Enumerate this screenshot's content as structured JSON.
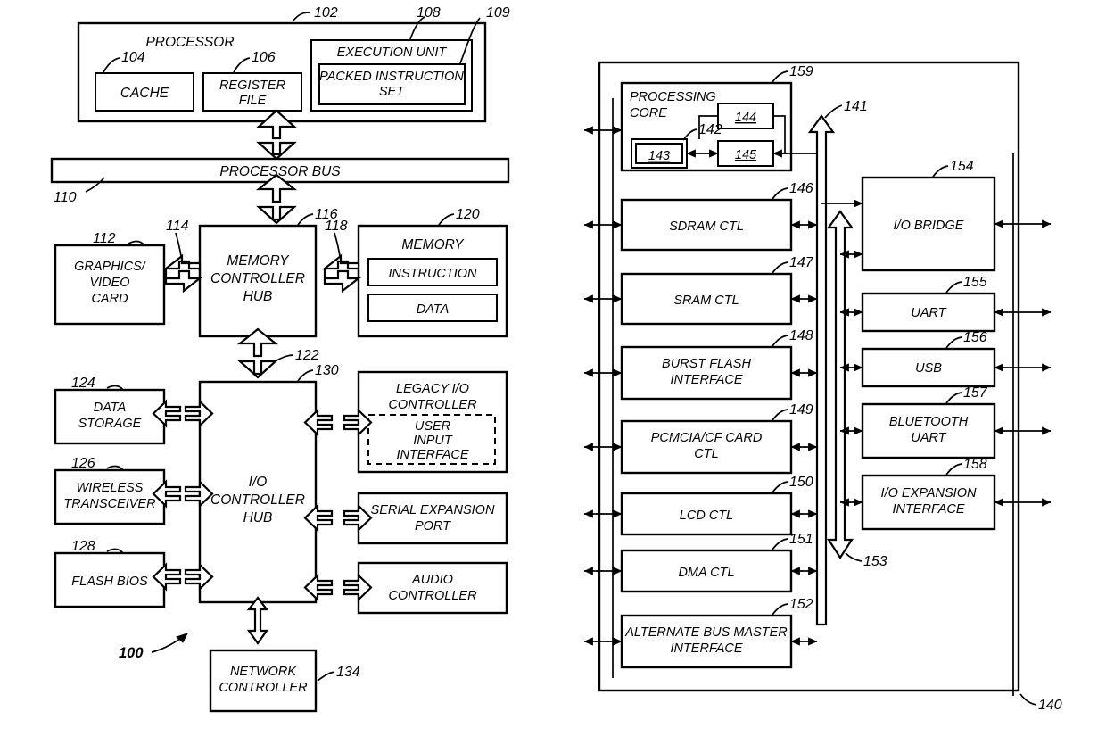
{
  "figure": {
    "title_left_ref": "100",
    "title_right_ref": "140"
  },
  "left_diagram": {
    "ref": "100",
    "processor": {
      "ref": "102",
      "label": "PROCESSOR",
      "cache": {
        "ref": "104",
        "label": "CACHE"
      },
      "register_file": {
        "ref": "106",
        "label": "REGISTER FILE",
        "line1": "REGISTER",
        "line2": "FILE"
      },
      "execution_unit": {
        "ref": "108",
        "label": "EXECUTION UNIT",
        "packed_instruction_set": {
          "ref": "109",
          "line1": "PACKED INSTRUCTION",
          "line2": "SET"
        }
      }
    },
    "processor_bus": {
      "ref": "110",
      "label": "PROCESSOR BUS"
    },
    "graphics_video_card": {
      "ref": "112",
      "line1": "GRAPHICS/",
      "line2": "VIDEO",
      "line3": "CARD"
    },
    "bus_114": {
      "ref": "114"
    },
    "memory_controller_hub": {
      "ref": "116",
      "line1": "MEMORY",
      "line2": "CONTROLLER",
      "line3": "HUB"
    },
    "bus_118": {
      "ref": "118"
    },
    "memory": {
      "ref": "120",
      "label": "MEMORY",
      "instruction": "INSTRUCTION",
      "data": "DATA"
    },
    "bus_122": {
      "ref": "122"
    },
    "data_storage": {
      "ref": "124",
      "line1": "DATA",
      "line2": "STORAGE"
    },
    "wireless_transceiver": {
      "ref": "126",
      "line1": "WIRELESS",
      "line2": "TRANSCEIVER"
    },
    "flash_bios": {
      "ref": "128",
      "label": "FLASH BIOS"
    },
    "io_controller_hub": {
      "ref": "130",
      "line1": "I/O",
      "line2": "CONTROLLER",
      "line3": "HUB"
    },
    "legacy_io_controller": {
      "line1": "LEGACY I/O",
      "line2": "CONTROLLER",
      "user_input_interface": {
        "line1": "USER",
        "line2": "INPUT",
        "line3": "INTERFACE"
      }
    },
    "serial_expansion_port": {
      "line1": "SERIAL EXPANSION",
      "line2": "PORT"
    },
    "audio_controller": {
      "line1": "AUDIO",
      "line2": "CONTROLLER"
    },
    "network_controller": {
      "ref": "134",
      "line1": "NETWORK",
      "line2": "CONTROLLER"
    }
  },
  "right_diagram": {
    "ref": "140",
    "processing_core": {
      "ref": "159",
      "line1": "PROCESSING",
      "line2": "CORE",
      "inner": {
        "cache_142": {
          "ref": "142"
        },
        "box_143": {
          "ref": "143"
        },
        "box_144": {
          "ref": "144"
        },
        "box_145": {
          "ref": "145"
        }
      }
    },
    "main_bus": {
      "ref": "141"
    },
    "io_bus": {
      "ref": "153"
    },
    "left_column": [
      {
        "ref": "146",
        "line1": "SDRAM CTL",
        "line2": ""
      },
      {
        "ref": "147",
        "line1": "SRAM CTL",
        "line2": ""
      },
      {
        "ref": "148",
        "line1": "BURST FLASH",
        "line2": "INTERFACE"
      },
      {
        "ref": "149",
        "line1": "PCMCIA/CF CARD",
        "line2": "CTL"
      },
      {
        "ref": "150",
        "line1": "LCD CTL",
        "line2": ""
      },
      {
        "ref": "151",
        "line1": "DMA CTL",
        "line2": ""
      },
      {
        "ref": "152",
        "line1": "ALTERNATE BUS MASTER",
        "line2": "INTERFACE"
      }
    ],
    "right_column": [
      {
        "ref": "154",
        "line1": "I/O BRIDGE",
        "line2": ""
      },
      {
        "ref": "155",
        "line1": "UART",
        "line2": ""
      },
      {
        "ref": "156",
        "line1": "USB",
        "line2": ""
      },
      {
        "ref": "157",
        "line1": "BLUETOOTH",
        "line2": "UART"
      },
      {
        "ref": "158",
        "line1": "I/O EXPANSION",
        "line2": "INTERFACE"
      }
    ]
  }
}
